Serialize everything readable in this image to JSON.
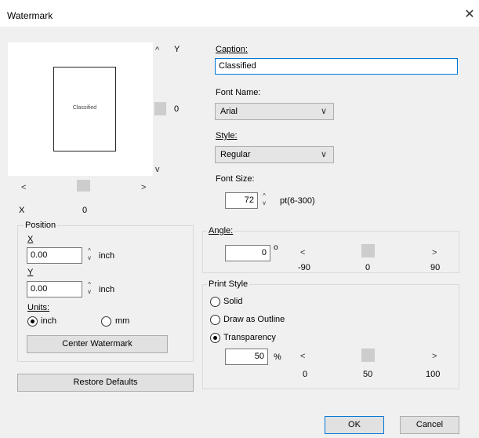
{
  "window": {
    "title": "Watermark"
  },
  "icons": {
    "close": "✕",
    "up": "^",
    "down": "v",
    "left": "<",
    "right": ">",
    "spin_up": "^",
    "spin_down": "v",
    "chevron": "∨"
  },
  "preview": {
    "page_caption": "Classified",
    "y_label": "Y",
    "y_value": "0",
    "x_label": "X",
    "x_value": "0"
  },
  "position": {
    "group_label": "Position",
    "x_label": "X",
    "x_value": "0.00",
    "x_unit": "inch",
    "y_label": "Y",
    "y_value": "0.00",
    "y_unit": "inch",
    "units_label": "Units:",
    "unit_inch": "inch",
    "unit_mm": "mm",
    "center_button": "Center Watermark"
  },
  "restore_button": "Restore Defaults",
  "caption": {
    "label": "Caption:",
    "value": "Classified"
  },
  "font": {
    "label": "Font Name:",
    "value": "Arial"
  },
  "style": {
    "label": "Style:",
    "value": "Regular"
  },
  "size": {
    "label": "Font Size:",
    "value": "72",
    "range": "pt(6-300)"
  },
  "angle": {
    "label": "Angle:",
    "value": "0",
    "degree": "o",
    "min": "-90",
    "mid": "0",
    "max": "90",
    "level": 0.5
  },
  "print_style": {
    "group_label": "Print Style",
    "solid": "Solid",
    "outline": "Draw as Outline",
    "transparency": "Transparency",
    "selected": "transparency",
    "trans_value": "50",
    "percent": "%",
    "min": "0",
    "mid": "50",
    "max": "100",
    "level": 0.5
  },
  "buttons": {
    "ok": "OK",
    "cancel": "Cancel"
  }
}
